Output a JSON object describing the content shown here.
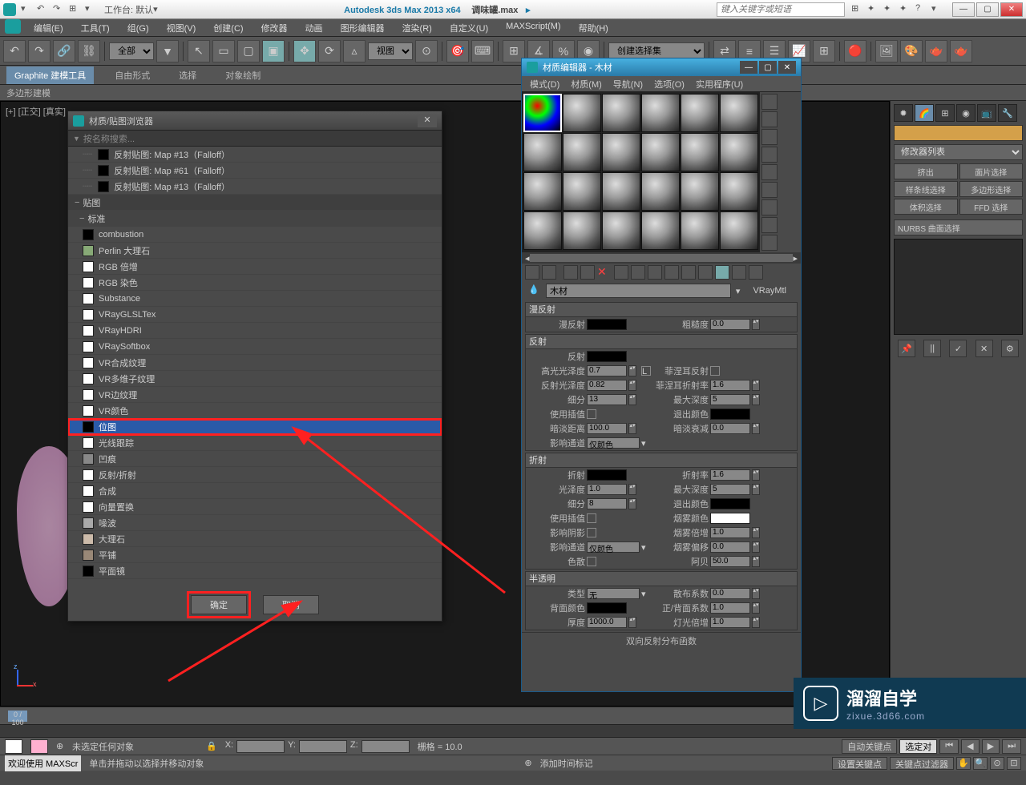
{
  "titlebar": {
    "app": "Autodesk 3ds Max  2013 x64",
    "doc": "调味罐.max",
    "workspace_label": "工作台: 默认",
    "search_placeholder": "键入关键字或短语"
  },
  "menubar": [
    "编辑(E)",
    "工具(T)",
    "组(G)",
    "视图(V)",
    "创建(C)",
    "修改器",
    "动画",
    "图形编辑器",
    "渲染(R)",
    "自定义(U)",
    "MAXScript(M)",
    "帮助(H)"
  ],
  "subtoolbar": {
    "tab1": "Graphite 建模工具",
    "tab2": "自由形式",
    "tab3": "选择",
    "tab4": "对象绘制",
    "row2": "多边形建模"
  },
  "toolbar": {
    "scope": "全部",
    "viewsel": "视图",
    "quickset": "创建选择集"
  },
  "viewport_label": "[+] [正交] [真实]",
  "rightpanel": {
    "modlist": "修改器列表",
    "btns": [
      "挤出",
      "面片选择",
      "样条线选择",
      "多边形选择",
      "体积选择",
      "FFD 选择"
    ],
    "nurbs": "NURBS 曲面选择"
  },
  "browser": {
    "title": "材质/贴图浏览器",
    "search": "按名称搜索...",
    "history": [
      "反射贴图: Map #13（Falloff）",
      "反射贴图: Map #61（Falloff）",
      "反射贴图: Map #13（Falloff）"
    ],
    "section": "贴图",
    "subsection": "标准",
    "items": [
      "combustion",
      "Perlin 大理石",
      "RGB 倍增",
      "RGB 染色",
      "Substance",
      "VRayGLSLTex",
      "VRayHDRI",
      "VRaySoftbox",
      "VR合成纹理",
      "VR多维子纹理",
      "VR边纹理",
      "VR颜色",
      "位图",
      "光线跟踪",
      "凹痕",
      "反射/折射",
      "合成",
      "向量置换",
      "噪波",
      "大理石",
      "平铺",
      "平面镜"
    ],
    "selected": "位图",
    "highlighted": "位图",
    "ok": "确定",
    "cancel": "取消"
  },
  "matedit": {
    "title": "材质编辑器 - 木材",
    "menu": [
      "模式(D)",
      "材质(M)",
      "导航(N)",
      "选项(O)",
      "实用程序(U)"
    ],
    "name": "木材",
    "type": "VRayMtl",
    "rollouts": {
      "diffuse": {
        "head": "漫反射",
        "lbl_diffuse": "漫反射",
        "lbl_rough": "粗糙度",
        "rough": "0.0"
      },
      "reflect": {
        "head": "反射",
        "lbl_reflect": "反射",
        "lbl_hilight": "高光光泽度",
        "hilight": "0.7",
        "lbl_refglossy": "反射光泽度",
        "refglossy": "0.82",
        "lbl_subdiv": "细分",
        "subdiv": "13",
        "lbl_useinterp": "使用插值",
        "lbl_dimdist": "暗淡距离",
        "dimdist": "100.0",
        "lbl_affect": "影响通道",
        "affect": "仅颜色",
        "lbl_fresnel": "菲涅耳反射",
        "lbl_fresnelior": "菲涅耳折射率",
        "fresnelior": "1.6",
        "lbl_maxdepth": "最大深度",
        "maxdepth": "5",
        "lbl_exitcolor": "退出颜色",
        "lbl_dimfall": "暗淡衰减",
        "dimfall": "0.0"
      },
      "refract": {
        "head": "折射",
        "lbl_refract": "折射",
        "lbl_glossy": "光泽度",
        "glossy": "1.0",
        "lbl_subdiv": "细分",
        "subdiv": "8",
        "lbl_useinterp": "使用插值",
        "lbl_affectshad": "影响阴影",
        "lbl_affect": "影响通道",
        "affect": "仅颜色",
        "lbl_disp": "色散",
        "lbl_ior": "折射率",
        "ior": "1.6",
        "lbl_maxdepth": "最大深度",
        "maxdepth": "5",
        "lbl_exitcolor": "退出颜色",
        "lbl_fogcolor": "烟雾颜色",
        "lbl_fogmult": "烟雾倍增",
        "fogmult": "1.0",
        "lbl_fogbias": "烟雾偏移",
        "fogbias": "0.0",
        "lbl_abbe": "阿贝",
        "abbe": "50.0"
      },
      "translucency": {
        "head": "半透明",
        "lbl_type": "类型",
        "type": "无",
        "lbl_backcolor": "背面颜色",
        "lbl_thickness": "厚度",
        "thickness": "1000.0",
        "lbl_scatter": "散布系数",
        "scatter": "0.0",
        "lbl_fwdback": "正/背面系数",
        "fwdback": "1.0",
        "lbl_lightmult": "灯光倍增",
        "lightmult": "1.0"
      },
      "brdf": "双向反射分布函数"
    }
  },
  "timeline": {
    "frame": "0",
    "range": "0 / 100"
  },
  "status": {
    "noselect": "未选定任何对象",
    "hint": "单击并拖动以选择并移动对象",
    "x": "X:",
    "y": "Y:",
    "z": "Z:",
    "grid": "栅格 = 10.0",
    "autokey": "自动关键点",
    "selset": "选定对",
    "setkey": "设置关键点",
    "keyfilter": "关键点过滤器",
    "addtime": "添加时间标记",
    "welcome": "欢迎使用  MAXScr"
  },
  "watermark": {
    "big": "溜溜自学",
    "small": "zixue.3d66.com"
  }
}
